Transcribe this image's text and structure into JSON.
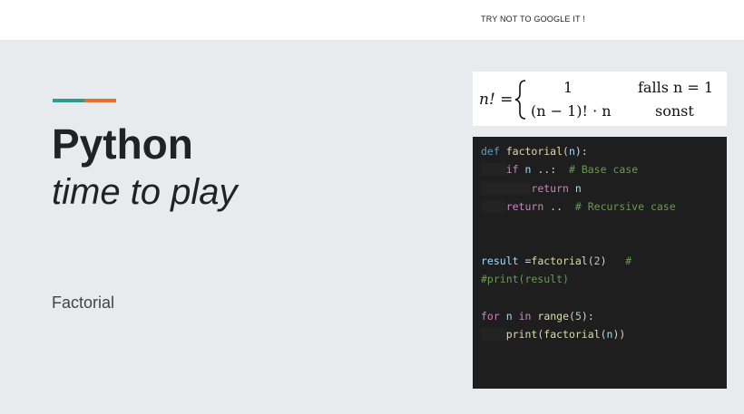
{
  "header": {
    "tagline": "TRY NOT TO GOOGLE IT !"
  },
  "colors": {
    "accent_teal": "#2a9d8f",
    "accent_orange": "#e76f2a",
    "background": "#e8ebee"
  },
  "slide": {
    "title": "Python",
    "subtitle": "time to play",
    "label": "Factorial"
  },
  "formula": {
    "lhs": "n! =",
    "case1_value": "1",
    "case1_condition": "falls n = 1",
    "case2_value": "(n − 1)! · n",
    "case2_condition": "sonst"
  },
  "code": {
    "l1": [
      "def",
      " ",
      "factorial",
      "(",
      "n",
      "):"
    ],
    "l2": [
      "if",
      " ",
      "n",
      " ..:  ",
      "# Base case"
    ],
    "l3": [
      "return",
      " ",
      "n"
    ],
    "l4": [
      "return",
      " ..  ",
      "# Recursive case"
    ],
    "l5": [
      "result",
      " =",
      "factorial",
      "(",
      "2",
      ")   ",
      "#"
    ],
    "l6": [
      "#print(result)"
    ],
    "l7": [
      "for",
      " ",
      "n",
      " ",
      "in",
      " ",
      "range",
      "(",
      "5",
      "):"
    ],
    "l8": [
      "print",
      "(",
      "factorial",
      "(",
      "n",
      "))"
    ]
  }
}
